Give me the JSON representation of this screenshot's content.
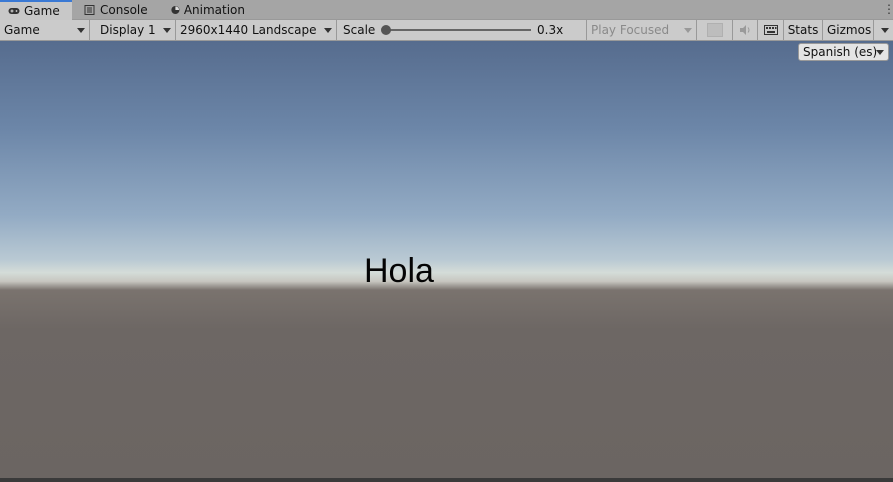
{
  "tabs": [
    {
      "label": "Game",
      "icon": "gamepad-icon",
      "active": true
    },
    {
      "label": "Console",
      "icon": "console-icon",
      "active": false
    },
    {
      "label": "Animation",
      "icon": "animation-icon",
      "active": false
    }
  ],
  "toolbar": {
    "view_mode": "Game",
    "display": "Display 1",
    "resolution": "2960x1440 Landscape",
    "scale_label": "Scale",
    "scale_value": "0.3x",
    "scale_level": 0.0,
    "play_mode": "Play Focused",
    "stats": "Stats",
    "gizmos": "Gizmos"
  },
  "viewport": {
    "language": "Spanish (es)",
    "greeting": "Hola"
  }
}
